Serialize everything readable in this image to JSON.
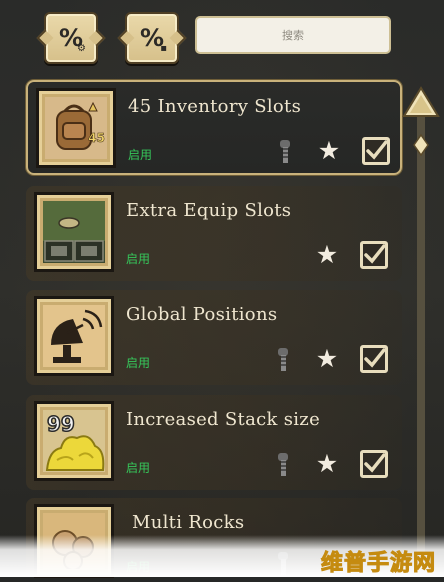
{
  "search": {
    "placeholder": "搜索"
  },
  "filters": [
    {
      "name": "filter-enabled"
    },
    {
      "name": "filter-disabled"
    }
  ],
  "mods": [
    {
      "title": "45 Inventory Slots",
      "status": "启用",
      "favorited": true,
      "enabled": true,
      "has_config": true,
      "selected": true,
      "badge": "45"
    },
    {
      "title": "Extra Equip Slots",
      "status": "启用",
      "favorited": true,
      "enabled": true,
      "has_config": false,
      "selected": false
    },
    {
      "title": "Global Positions",
      "status": "启用",
      "favorited": true,
      "enabled": true,
      "has_config": true,
      "selected": false
    },
    {
      "title": "Increased Stack size",
      "status": "启用",
      "favorited": true,
      "enabled": true,
      "has_config": true,
      "selected": false,
      "badge": "99"
    },
    {
      "title": "Multi Rocks",
      "status": "启用",
      "favorited": true,
      "enabled": true,
      "has_config": true,
      "selected": false
    }
  ],
  "watermark": "维普手游网",
  "colors": {
    "status_green": "#36c65a",
    "title": "#efe6cf",
    "frame_gold": "#c9b27b"
  }
}
